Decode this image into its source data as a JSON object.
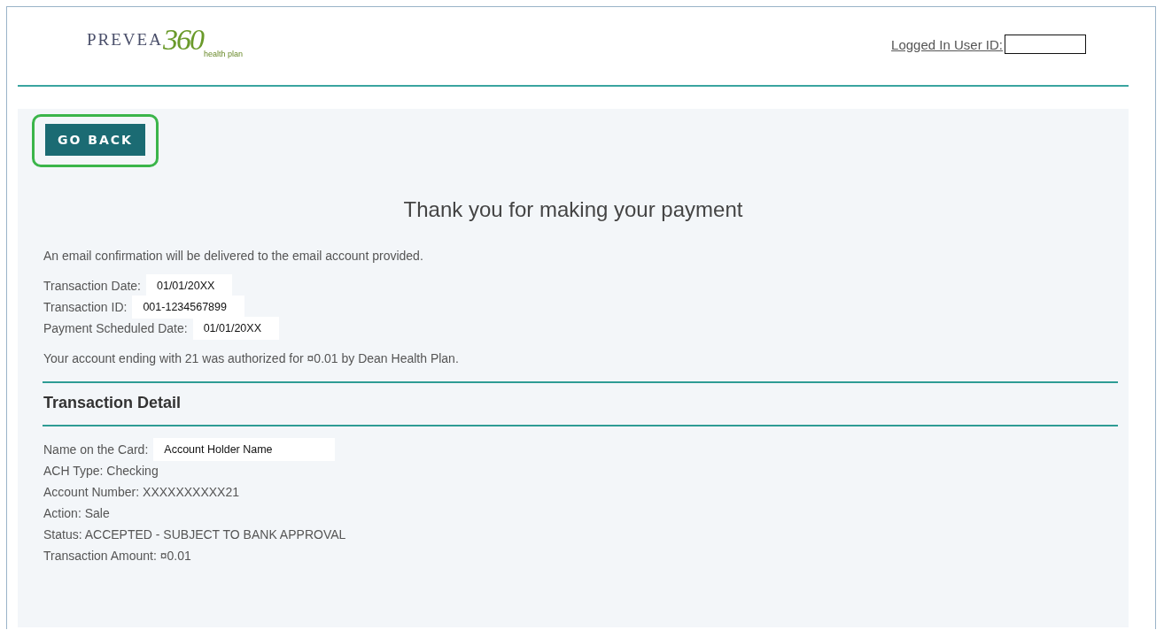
{
  "header": {
    "logo": {
      "name": "PREVEA",
      "number": "360",
      "tagline": "health plan"
    },
    "user_label": "Logged In User ID:"
  },
  "back_button": {
    "label": "GO BACK",
    "highlighted": true
  },
  "title": "Thank you for making your payment",
  "notice": "An email confirmation will be delivered to the email account provided.",
  "summary": [
    {
      "label": "Transaction Date:",
      "value": "01/01/20XX"
    },
    {
      "label": "Transaction ID:",
      "value": "001-1234567899"
    },
    {
      "label": "Payment Scheduled Date:",
      "value": "01/01/20XX"
    }
  ],
  "authorization": "Your account ending with 21 was authorized for ¤0.01 by Dean Health Plan.",
  "detail": {
    "heading": "Transaction Detail",
    "rows": [
      {
        "kind": "redacted",
        "label": "Name on the Card:",
        "value": "Account Holder Name"
      },
      {
        "kind": "plain",
        "text": "ACH Type: Checking"
      },
      {
        "kind": "plain",
        "text": "Account Number: XXXXXXXXXX21"
      },
      {
        "kind": "plain",
        "text": "Action: Sale"
      },
      {
        "kind": "plain",
        "text": "Status: ACCEPTED - SUBJECT TO BANK APPROVAL"
      },
      {
        "kind": "plain",
        "text": "Transaction Amount: ¤0.01"
      }
    ]
  }
}
